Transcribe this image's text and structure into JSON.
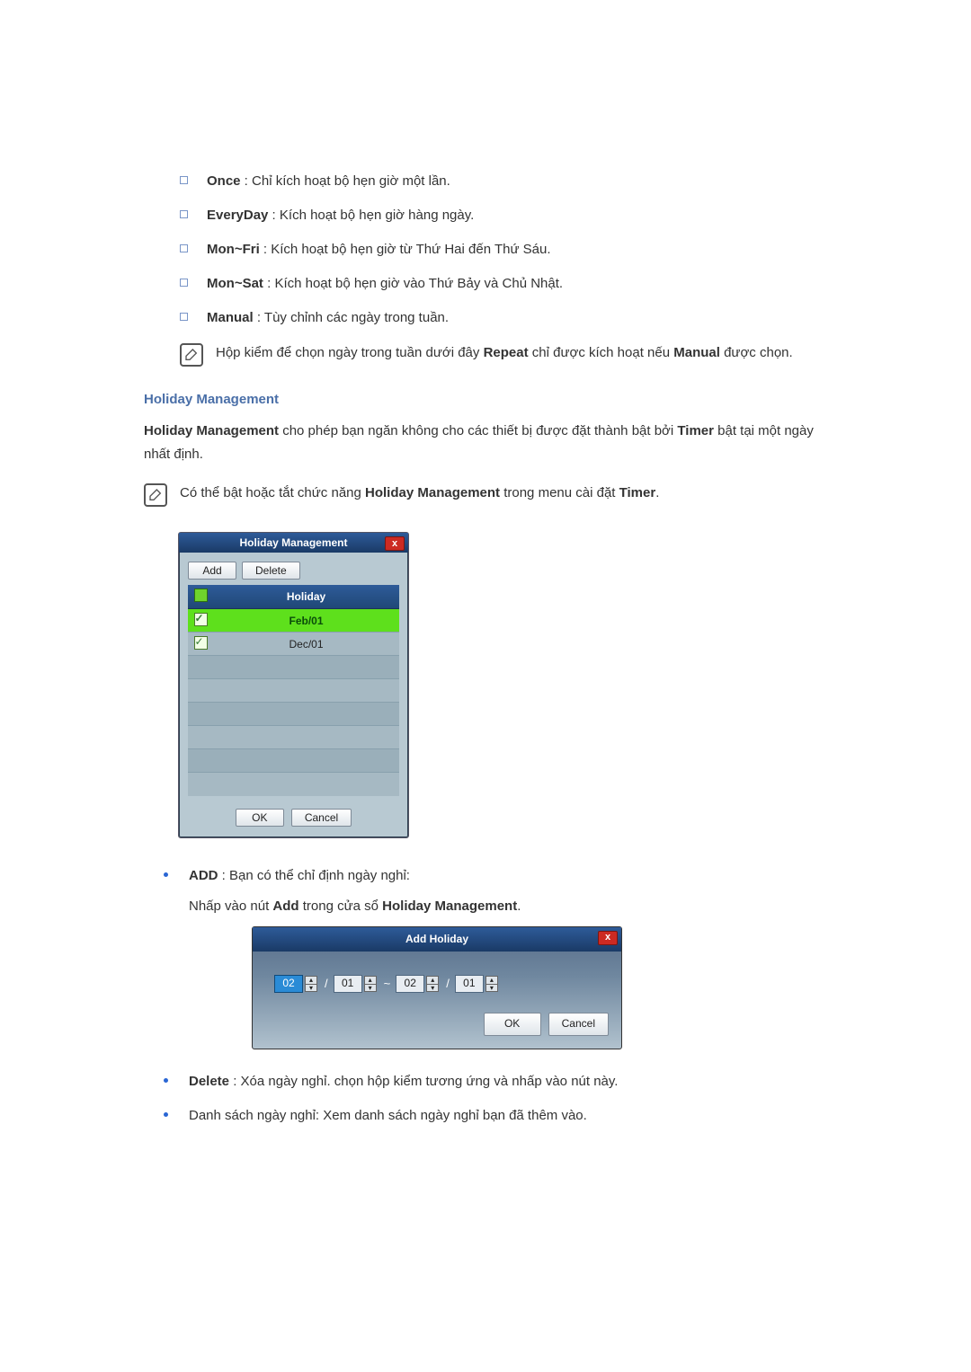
{
  "options": [
    {
      "label": "Once",
      "desc": " : Chỉ kích hoạt bộ hẹn giờ một lần."
    },
    {
      "label": "EveryDay",
      "desc": " : Kích hoạt bộ hẹn giờ hàng ngày."
    },
    {
      "label": "Mon~Fri",
      "desc": " : Kích hoạt bộ hẹn giờ từ Thứ Hai đến Thứ Sáu."
    },
    {
      "label": "Mon~Sat",
      "desc": " : Kích hoạt bộ hẹn giờ vào Thứ Bảy và Chủ Nhật."
    },
    {
      "label": "Manual",
      "desc": " : Tùy chỉnh các ngày trong tuần."
    }
  ],
  "note1": {
    "pre": "Hộp kiểm để chọn ngày trong tuần dưới đây ",
    "b1": "Repeat",
    "mid": " chỉ được kích hoạt nếu ",
    "b2": "Manual",
    "post": " được chọn."
  },
  "hm": {
    "section_title": "Holiday Management",
    "intro_bold": "Holiday Management",
    "intro_mid": " cho phép bạn ngăn không cho các thiết bị được đặt thành bật bởi ",
    "intro_b2": "Timer",
    "intro_end": " bật tại một ngày nhất định."
  },
  "note2": {
    "pre": "Có thể bật hoặc tắt chức năng ",
    "b1": "Holiday Management",
    "mid": " trong menu cài đặt ",
    "b2": "Timer",
    "post": "."
  },
  "hm_window": {
    "title": "Holiday Management",
    "close": "x",
    "btn_add": "Add",
    "btn_delete": "Delete",
    "header_text": "Holiday",
    "rows": [
      {
        "checked": true,
        "selected": true,
        "text": "Feb/01"
      },
      {
        "checked": true,
        "selected": false,
        "text": "Dec/01"
      }
    ],
    "btn_ok": "OK",
    "btn_cancel": "Cancel"
  },
  "bullets": {
    "add_label": "ADD",
    "add_text": " : Bạn có thể chỉ định ngày nghỉ:",
    "add_line2a": "Nhấp vào nút ",
    "add_line2b": "Add",
    "add_line2c": " trong cửa sổ ",
    "add_line2d": "Holiday Management",
    "add_line2e": ".",
    "delete_label": "Delete",
    "delete_text": " : Xóa ngày nghỉ. chọn hộp kiểm tương ứng và nhấp vào nút này.",
    "list_text": "Danh sách ngày nghỉ: Xem danh sách ngày nghỉ bạn đã thêm vào."
  },
  "ah_window": {
    "title": "Add Holiday",
    "close": "x",
    "m1": "02",
    "d1": "01",
    "tilde": "~",
    "m2": "02",
    "d2": "01",
    "slash": "/",
    "btn_ok": "OK",
    "btn_cancel": "Cancel"
  }
}
